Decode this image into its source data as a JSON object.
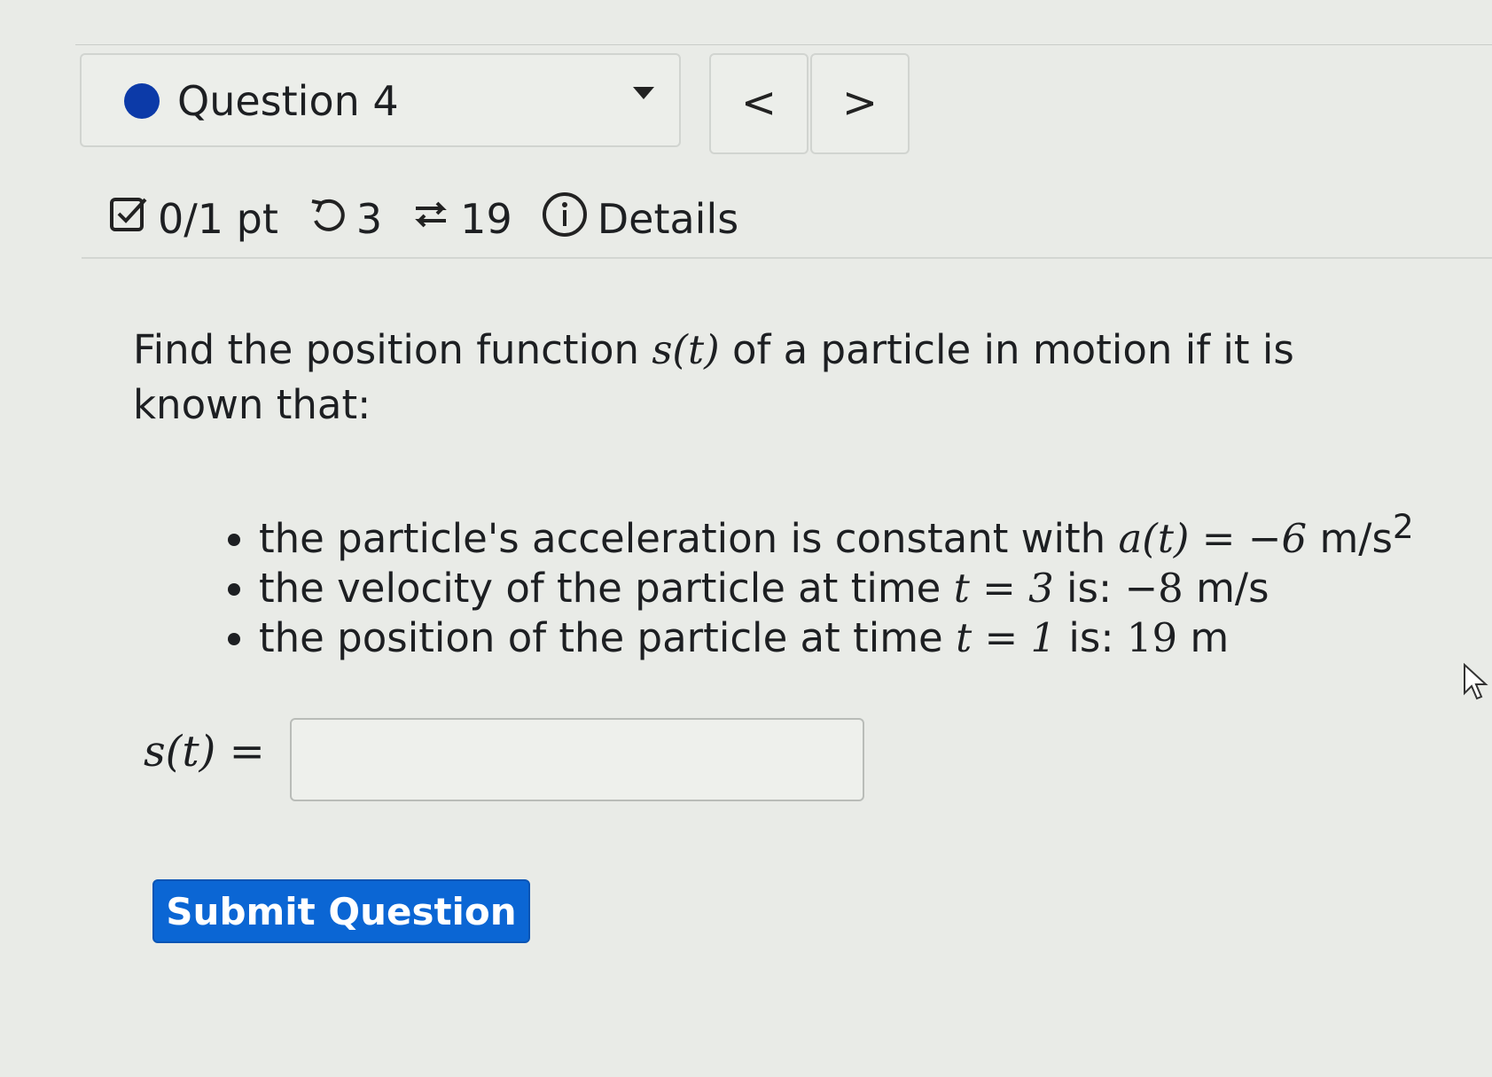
{
  "question_selector": {
    "label": "Question 4",
    "status_color": "#0c3aa8"
  },
  "nav": {
    "prev_label": "<",
    "next_label": ">"
  },
  "meta": {
    "score": "0/1 pt",
    "attempts": "3",
    "retries": "19",
    "details_label": "Details"
  },
  "prompt": {
    "part1": "Find the position function ",
    "func": "s(t)",
    "part2": " of a particle in motion if it is known that:"
  },
  "conditions": [
    {
      "text": "the particle's acceleration is constant with ",
      "math": "a(t) = −6",
      "unit": " m/s",
      "sup": "2"
    },
    {
      "text": "the velocity of the particle at time ",
      "math": "t = 3",
      "text2": " is: ",
      "math2": "−8",
      "unit": " m/s"
    },
    {
      "text": "the position of the particle at time ",
      "math": "t = 1",
      "text2": " is: ",
      "math2": "19",
      "unit": " m"
    }
  ],
  "answer": {
    "label": "s(t) =",
    "value": "",
    "placeholder": ""
  },
  "submit_label": "Submit Question",
  "colors": {
    "accent": "#0b66d4",
    "background": "#e9ebe7"
  }
}
